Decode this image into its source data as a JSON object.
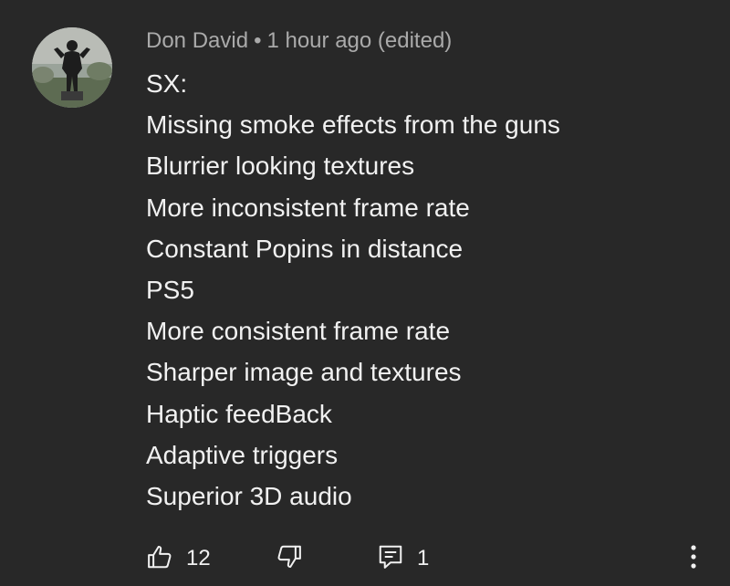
{
  "comment": {
    "author": "Don David",
    "separator": "•",
    "time": "1 hour ago",
    "edited_label": "(edited)",
    "lines": [
      "SX:",
      "Missing smoke effects from the guns",
      "Blurrier looking textures",
      "More inconsistent frame rate",
      "Constant Popins in distance",
      "PS5",
      "More consistent frame rate",
      "Sharper image and textures",
      "Haptic feedBack",
      "Adaptive triggers",
      "Superior 3D audio"
    ],
    "like_count": "12",
    "reply_count": "1"
  },
  "icons": {
    "like": "thumbs-up-icon",
    "dislike": "thumbs-down-icon",
    "replies": "comment-icon",
    "more": "more-vertical-icon"
  },
  "colors": {
    "background": "#282828",
    "text": "#f1f1f1",
    "meta": "#aaaaaa"
  }
}
